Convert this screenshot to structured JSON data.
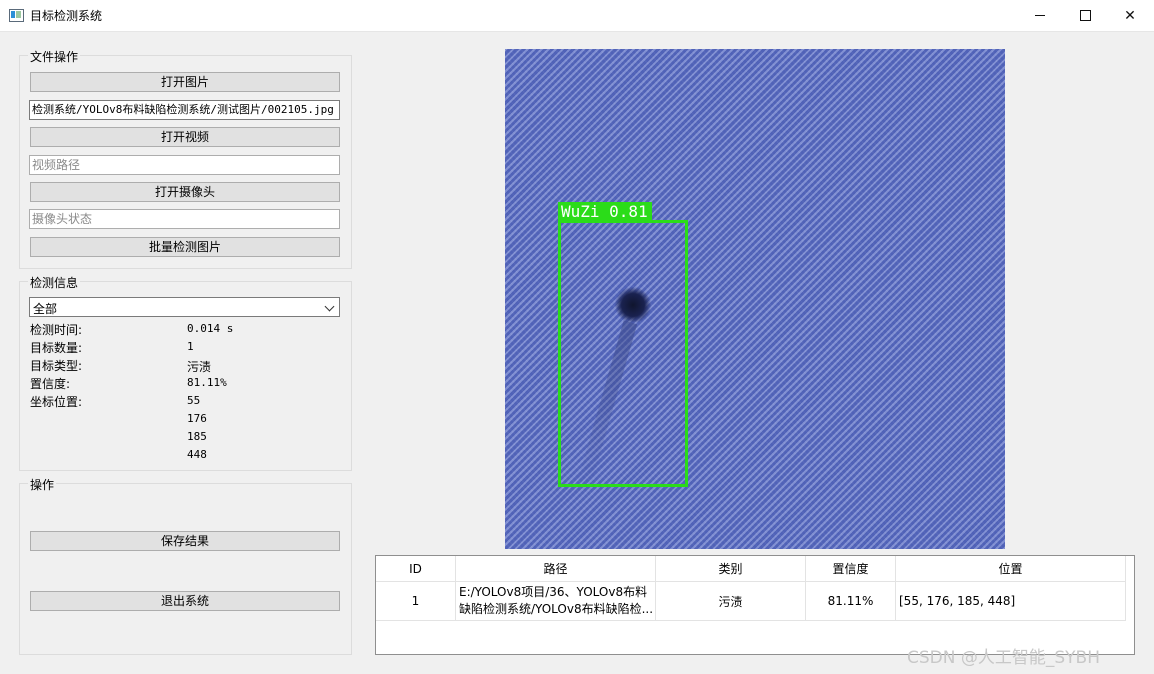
{
  "window": {
    "title": "目标检测系统"
  },
  "file_ops": {
    "group_title": "文件操作",
    "open_image_label": "打开图片",
    "image_path_value": "检测系统/YOLOv8布料缺陷检测系统/测试图片/002105.jpg",
    "open_video_label": "打开视频",
    "video_path_placeholder": "视频路径",
    "open_camera_label": "打开摄像头",
    "camera_status_placeholder": "摄像头状态",
    "batch_detect_label": "批量检测图片"
  },
  "detect_info": {
    "group_title": "检测信息",
    "select_value": "全部",
    "time_label": "检测时间:",
    "time_value": "0.014 s",
    "count_label": "目标数量:",
    "count_value": "1",
    "type_label": "目标类型:",
    "type_value": "污渍",
    "conf_label": "置信度:",
    "conf_value": "81.11%",
    "coord_label": "坐标位置:",
    "coords": [
      "55",
      "176",
      "185",
      "448"
    ]
  },
  "operations": {
    "group_title": "操作",
    "save_label": "保存结果",
    "exit_label": "退出系统"
  },
  "detection": {
    "label": "WuZi 0.81",
    "box_color": "#2bdc19",
    "fabric_color": "#5d70c6"
  },
  "table": {
    "headers": [
      "ID",
      "路径",
      "类别",
      "置信度",
      "位置"
    ],
    "rows": [
      {
        "id": "1",
        "path_line1": "E:/YOLOv8项目/36、YOLOv8布料",
        "path_line2": "缺陷检测系统/YOLOv8布料缺陷检...",
        "category": "污渍",
        "confidence": "81.11%",
        "position": "[55, 176, 185, 448]"
      }
    ]
  },
  "watermark": "CSDN @人工智能_SYBH"
}
